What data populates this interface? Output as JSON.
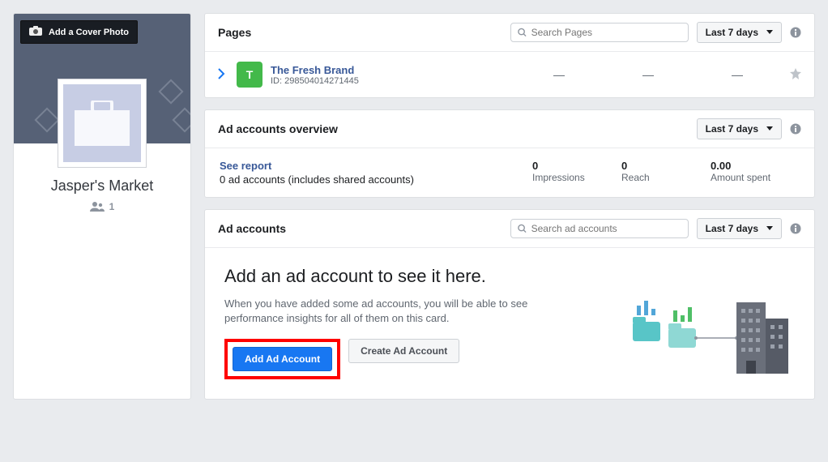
{
  "sidebar": {
    "cover_button_label": "Add a Cover Photo",
    "business_name": "Jasper's Market",
    "members_count": "1"
  },
  "pages_card": {
    "title": "Pages",
    "search_placeholder": "Search Pages",
    "date_label": "Last 7 days",
    "rows": [
      {
        "badge_letter": "T",
        "name": "The Fresh Brand",
        "id_label": "ID: 298504014271445",
        "metric1": "—",
        "metric2": "—",
        "metric3": "—"
      }
    ]
  },
  "overview_card": {
    "title": "Ad accounts overview",
    "date_label": "Last 7 days",
    "see_report": "See report",
    "subtitle": "0 ad accounts (includes shared accounts)",
    "stats": [
      {
        "value": "0",
        "label": "Impressions"
      },
      {
        "value": "0",
        "label": "Reach"
      },
      {
        "value": "0.00",
        "label": "Amount spent"
      }
    ]
  },
  "adaccounts_card": {
    "title": "Ad accounts",
    "search_placeholder": "Search ad accounts",
    "date_label": "Last 7 days",
    "empty_title": "Add an ad account to see it here.",
    "empty_desc": "When you have added some ad accounts, you will be able to see performance insights for all of them on this card.",
    "add_button": "Add Ad Account",
    "create_button": "Create Ad Account"
  }
}
